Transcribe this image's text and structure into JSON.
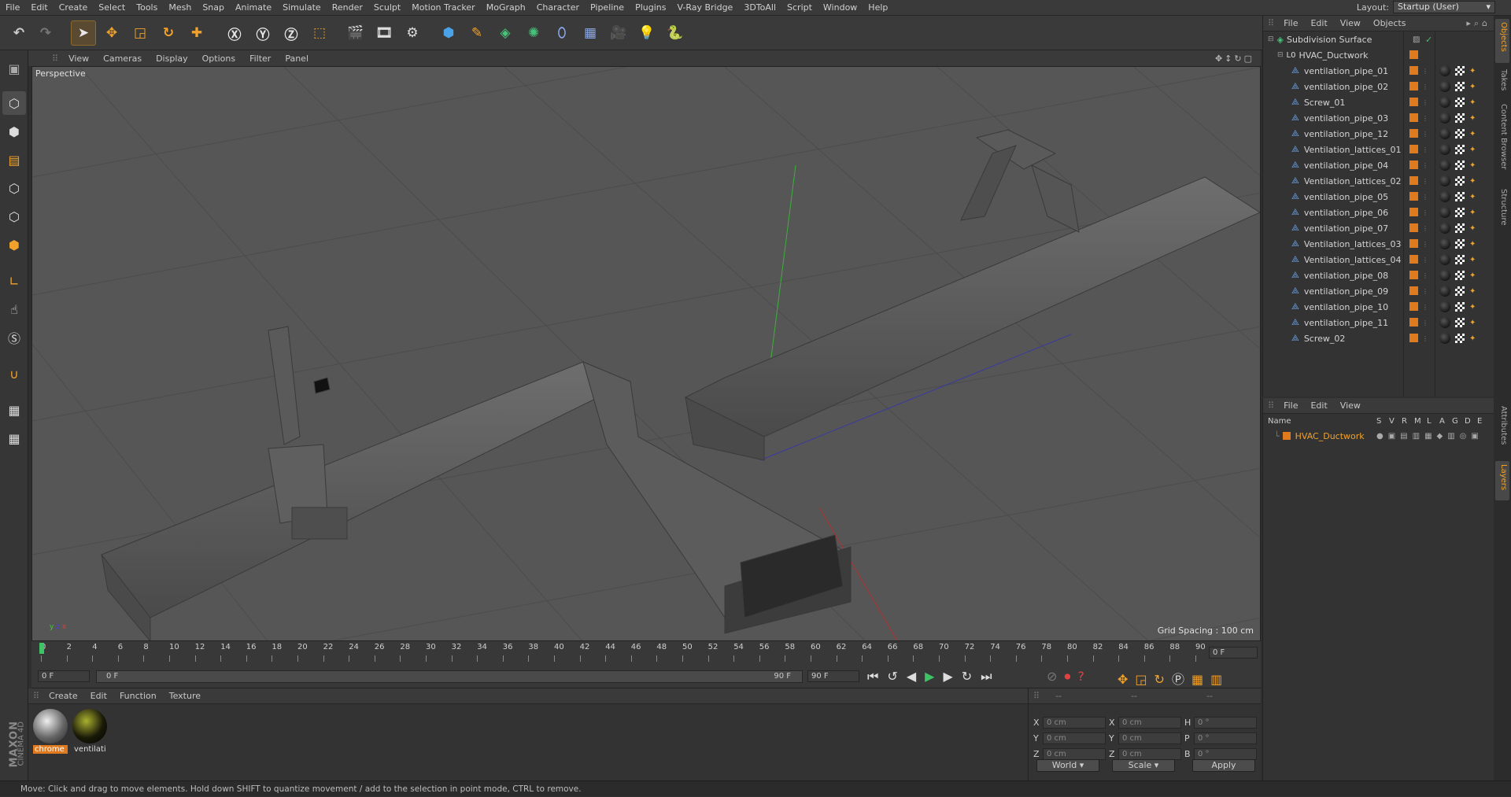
{
  "menu": [
    "File",
    "Edit",
    "Create",
    "Select",
    "Tools",
    "Mesh",
    "Snap",
    "Animate",
    "Simulate",
    "Render",
    "Sculpt",
    "Motion Tracker",
    "MoGraph",
    "Character",
    "Pipeline",
    "Plugins",
    "V-Ray Bridge",
    "3DToAll",
    "Script",
    "Window",
    "Help"
  ],
  "layout": {
    "label": "Layout:",
    "value": "Startup (User)"
  },
  "viewport": {
    "menu": [
      "View",
      "Cameras",
      "Display",
      "Options",
      "Filter",
      "Panel"
    ],
    "label": "Perspective",
    "grid_spacing": "Grid Spacing : 100 cm"
  },
  "timeline": {
    "ticks": [
      "0",
      "2",
      "4",
      "6",
      "8",
      "10",
      "12",
      "14",
      "16",
      "18",
      "20",
      "22",
      "24",
      "26",
      "28",
      "30",
      "32",
      "34",
      "36",
      "38",
      "40",
      "42",
      "44",
      "46",
      "48",
      "50",
      "52",
      "54",
      "56",
      "58",
      "60",
      "62",
      "64",
      "66",
      "68",
      "70",
      "72",
      "74",
      "76",
      "78",
      "80",
      "82",
      "84",
      "86",
      "88",
      "90"
    ],
    "current": "0 F",
    "end": "0 F"
  },
  "transport": {
    "start": "0 F",
    "slider_start": "0 F",
    "slider_end": "90 F",
    "end": "90 F"
  },
  "materials": {
    "menu": [
      "Create",
      "Edit",
      "Function",
      "Texture"
    ],
    "items": [
      {
        "name": "chrome"
      },
      {
        "name": "ventilati"
      }
    ]
  },
  "coords": {
    "headers": [
      "--",
      "--",
      "--"
    ],
    "rows": [
      {
        "a": "X",
        "av": "0 cm",
        "b": "X",
        "bv": "0 cm",
        "c": "H",
        "cv": "0 °"
      },
      {
        "a": "Y",
        "av": "0 cm",
        "b": "Y",
        "bv": "0 cm",
        "c": "P",
        "cv": "0 °"
      },
      {
        "a": "Z",
        "av": "0 cm",
        "b": "Z",
        "bv": "0 cm",
        "c": "B",
        "cv": "0 °"
      }
    ],
    "world": "World",
    "scale": "Scale",
    "apply": "Apply"
  },
  "objects": {
    "menu": [
      "File",
      "Edit",
      "View",
      "Objects"
    ],
    "root": "Subdivision Surface",
    "group": "HVAC_Ductwork",
    "items": [
      "ventilation_pipe_01",
      "ventilation_pipe_02",
      "Screw_01",
      "ventilation_pipe_03",
      "ventilation_pipe_12",
      "Ventilation_lattices_01",
      "ventilation_pipe_04",
      "Ventilation_lattices_02",
      "ventilation_pipe_05",
      "ventilation_pipe_06",
      "ventilation_pipe_07",
      "Ventilation_lattices_03",
      "Ventilation_lattices_04",
      "ventilation_pipe_08",
      "ventilation_pipe_09",
      "ventilation_pipe_10",
      "ventilation_pipe_11",
      "Screw_02"
    ]
  },
  "layers": {
    "menu": [
      "File",
      "Edit",
      "View"
    ],
    "cols": [
      "Name",
      "S",
      "V",
      "R",
      "M",
      "L",
      "A",
      "G",
      "D",
      "E"
    ],
    "row": "HVAC_Ductwork"
  },
  "right_tabs": [
    "Objects",
    "Takes",
    "Content Browser",
    "Structure",
    "Attributes",
    "Layers"
  ],
  "status": "Move: Click and drag to move elements. Hold down SHIFT to quantize movement / add to the selection in point mode, CTRL to remove.",
  "brand": {
    "maxon": "MAXON",
    "product": "CINEMA 4D"
  },
  "colors": {
    "accent": "#e07a1f",
    "bg": "#333333",
    "viewport": "#565656"
  }
}
